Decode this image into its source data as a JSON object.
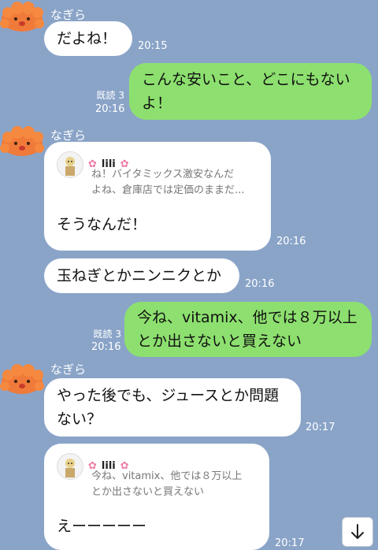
{
  "messages": [
    {
      "sender": "なぎら",
      "text": "だよね！",
      "time": "20:15"
    },
    {
      "text_line1": "こんな安いこと、どこにもない",
      "text_line2": "よ！",
      "read": "既読 3",
      "time": "20:16"
    },
    {
      "sender": "なぎら",
      "quote_name": "lili",
      "quote_line1": "ね！バイタミックス激安なんだ",
      "quote_line2": "よね、倉庫店では定価のままだ...",
      "text": "そうなんだ！",
      "time": "20:16"
    },
    {
      "text": "玉ねぎとかニンニクとか",
      "time": "20:16"
    },
    {
      "text_line1": "今ね、vitamix、他では８万以上",
      "text_line2": "とか出さないと買えない",
      "read": "既読 3",
      "time": "20:16"
    },
    {
      "sender": "なぎら",
      "text_line1": "やった後でも、ジュースとか問題",
      "text_line2": "ない？",
      "time": "20:17"
    },
    {
      "quote_name": "lili",
      "quote_line1": "今ね、vitamix、他では８万以上",
      "quote_line2": "とか出さないと買えない",
      "text": "えーーーーー",
      "time": "20:17"
    }
  ],
  "icons": {
    "avatar": "orange-fluffy-avatar-icon",
    "flower": "pink-flower-icon",
    "scroll": "arrow-down-icon"
  },
  "colors": {
    "background": "#8aa4c8",
    "incoming": "#ffffff",
    "outgoing": "#8de06f"
  }
}
